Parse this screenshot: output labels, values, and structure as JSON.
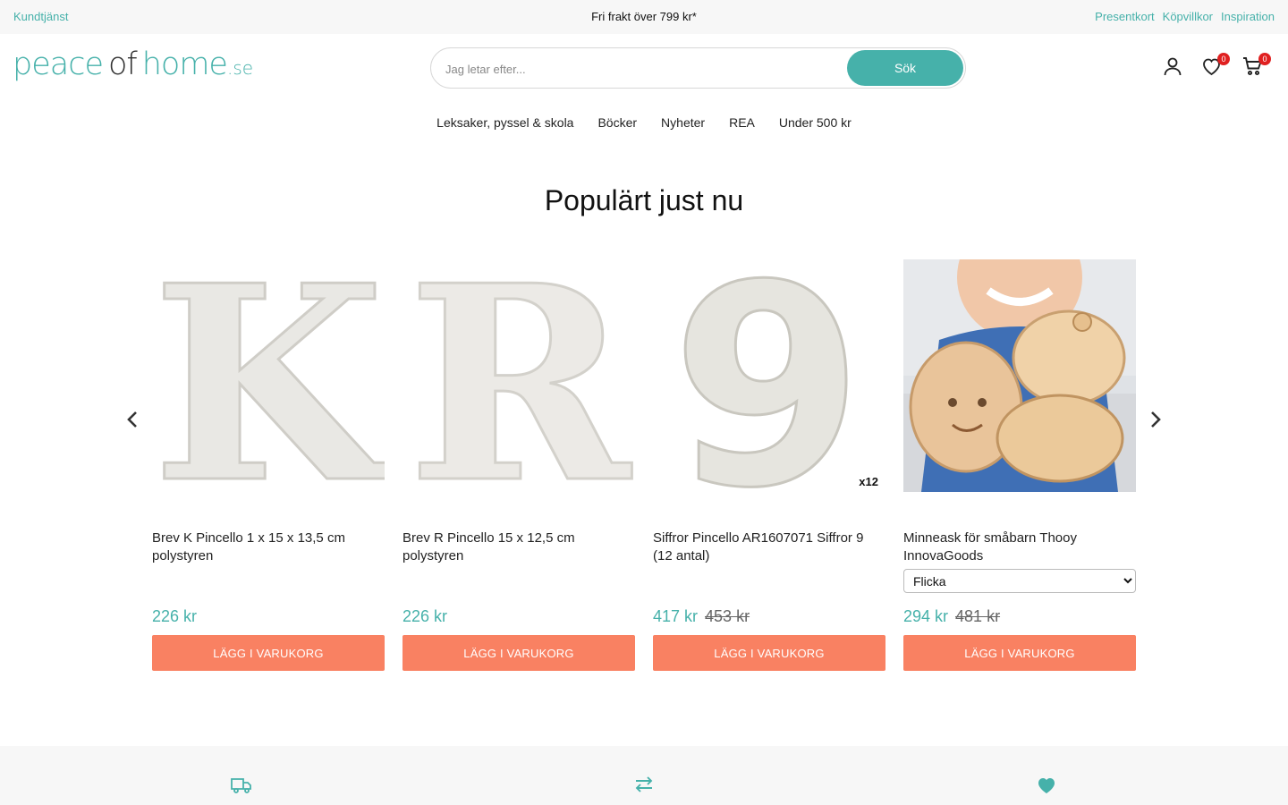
{
  "topbar": {
    "customer_service": "Kundtjänst",
    "free_shipping": "Fri frakt över 799 kr*",
    "links": [
      "Presentkort",
      "Köpvillkor",
      "Inspiration"
    ]
  },
  "logo": {
    "part1": "peace",
    "part2": "of",
    "part3": "home",
    "tld": ".se"
  },
  "search": {
    "placeholder": "Jag letar efter...",
    "button": "Sök"
  },
  "header_icons": {
    "account": "user-icon",
    "wishlist": "heart-icon",
    "cart": "cart-icon",
    "wishlist_count": "0",
    "cart_count": "0"
  },
  "nav": [
    "Leksaker, pyssel & skola",
    "Böcker",
    "Nyheter",
    "REA",
    "Under 500 kr"
  ],
  "section_title": "Populärt just nu",
  "products": [
    {
      "name": "Brev K Pincello 1 x 15 x 13,5 cm polystyren",
      "price": "226 kr",
      "old_price": "",
      "button": "LÄGG I VARUKORG",
      "image": "letter-k-image"
    },
    {
      "name": "Brev R Pincello 15 x 12,5 cm polystyren",
      "price": "226 kr",
      "old_price": "",
      "button": "LÄGG I VARUKORG",
      "image": "letter-r-image"
    },
    {
      "name": "Siffror Pincello AR1607071 Siffror 9 (12 antal)",
      "price": "417 kr",
      "old_price": "453 kr",
      "button": "LÄGG I VARUKORG",
      "image": "number-9-image",
      "image_badge": "x12"
    },
    {
      "name": "Minneask för småbarn Thooy InnovaGoods",
      "price": "294 kr",
      "old_price": "481 kr",
      "button": "LÄGG I VARUKORG",
      "image": "tooth-box-image",
      "variant": "Flicka"
    }
  ],
  "colors": {
    "accent": "#46b1aa",
    "buy_button": "#f98162",
    "badge": "#e02020"
  },
  "footer_icons": [
    "truck-icon",
    "exchange-icon",
    "heart-icon"
  ]
}
